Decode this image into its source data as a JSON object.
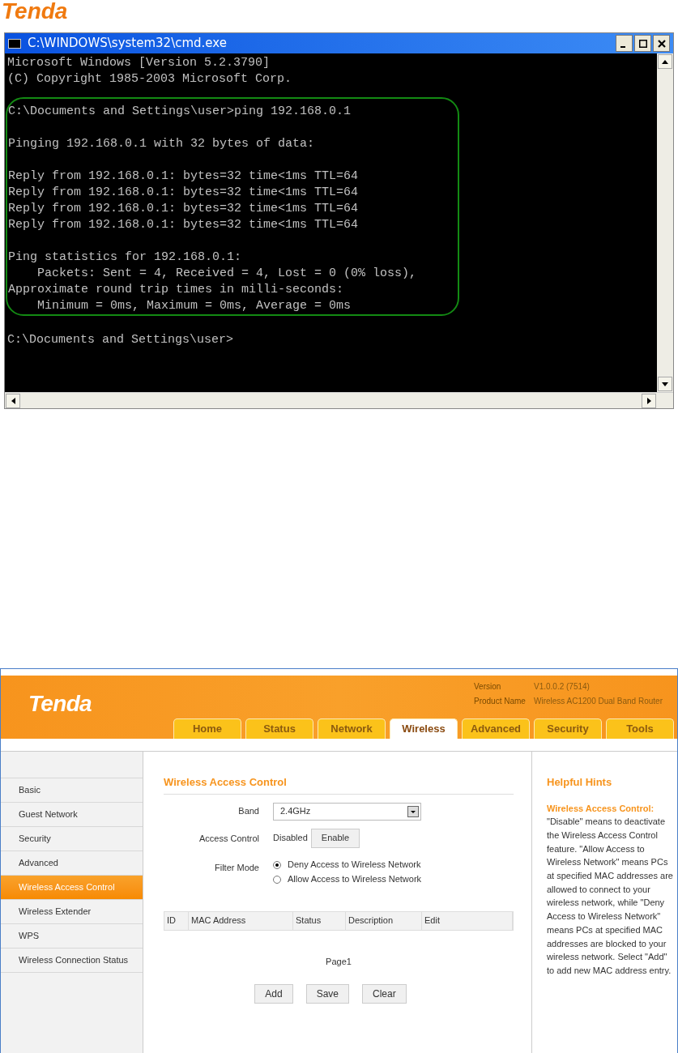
{
  "page_logo": "Tenda",
  "console": {
    "title": "C:\\WINDOWS\\system32\\cmd.exe",
    "blocks_before": [
      [
        "Microsoft Windows [Version 5.2.3790]",
        "(C) Copyright 1985-2003 Microsoft Corp."
      ]
    ],
    "highlighted_blocks": [
      [
        "C:\\Documents and Settings\\user>ping 192.168.0.1"
      ],
      [
        "Pinging 192.168.0.1 with 32 bytes of data:"
      ],
      [
        "Reply from 192.168.0.1: bytes=32 time<1ms TTL=64",
        "Reply from 192.168.0.1: bytes=32 time<1ms TTL=64",
        "Reply from 192.168.0.1: bytes=32 time<1ms TTL=64",
        "Reply from 192.168.0.1: bytes=32 time<1ms TTL=64"
      ],
      [
        "Ping statistics for 192.168.0.1:",
        "    Packets: Sent = 4, Received = 4, Lost = 0 (0% loss),",
        "Approximate round trip times in milli-seconds:",
        "    Minimum = 0ms, Maximum = 0ms, Average = 0ms"
      ]
    ],
    "blocks_after": [
      [
        "C:\\Documents and Settings\\user>"
      ]
    ]
  },
  "router": {
    "logo": "Tenda",
    "info": [
      {
        "label": "Version",
        "value": "V1.0.0.2 (7514)"
      },
      {
        "label": "Product Name",
        "value": "Wireless AC1200 Dual Band Router"
      }
    ],
    "tabs": [
      {
        "label": "Home",
        "selected": false
      },
      {
        "label": "Status",
        "selected": false
      },
      {
        "label": "Network",
        "selected": false
      },
      {
        "label": "Wireless",
        "selected": true
      },
      {
        "label": "Advanced",
        "selected": false
      },
      {
        "label": "Security",
        "selected": false
      },
      {
        "label": "Tools",
        "selected": false
      }
    ],
    "sidebar": [
      {
        "label": "Basic",
        "selected": false
      },
      {
        "label": "Guest Network",
        "selected": false
      },
      {
        "label": "Security",
        "selected": false
      },
      {
        "label": "Advanced",
        "selected": false
      },
      {
        "label": "Wireless Access Control",
        "selected": true
      },
      {
        "label": "Wireless Extender",
        "selected": false
      },
      {
        "label": "WPS",
        "selected": false
      },
      {
        "label": "Wireless Connection Status",
        "selected": false
      }
    ],
    "section_title": "Wireless Access Control",
    "band": {
      "label": "Band",
      "value": "2.4GHz"
    },
    "access_control": {
      "label": "Access Control",
      "status": "Disabled",
      "button": "Enable"
    },
    "filter_mode": {
      "label": "Filter Mode",
      "options": [
        {
          "label": "Deny Access to Wireless Network",
          "selected": true
        },
        {
          "label": "Allow Access to Wireless Network",
          "selected": false
        }
      ]
    },
    "table_columns": [
      "ID",
      "MAC Address",
      "Status",
      "Description",
      "Edit"
    ],
    "pager": "Page1",
    "buttons": [
      "Add",
      "Save",
      "Clear"
    ],
    "hints": {
      "title": "Helpful Hints",
      "lead": "Wireless Access Control:",
      "text": "\"Disable\" means to deactivate the Wireless Access Control feature. \"Allow Access to Wireless Network\" means PCs at specified MAC addresses are allowed to connect to your wireless network, while \"Deny Access to Wireless Network\" means PCs at specified MAC addresses are blocked to your wireless network. Select \"Add\" to add new MAC address entry."
    }
  }
}
